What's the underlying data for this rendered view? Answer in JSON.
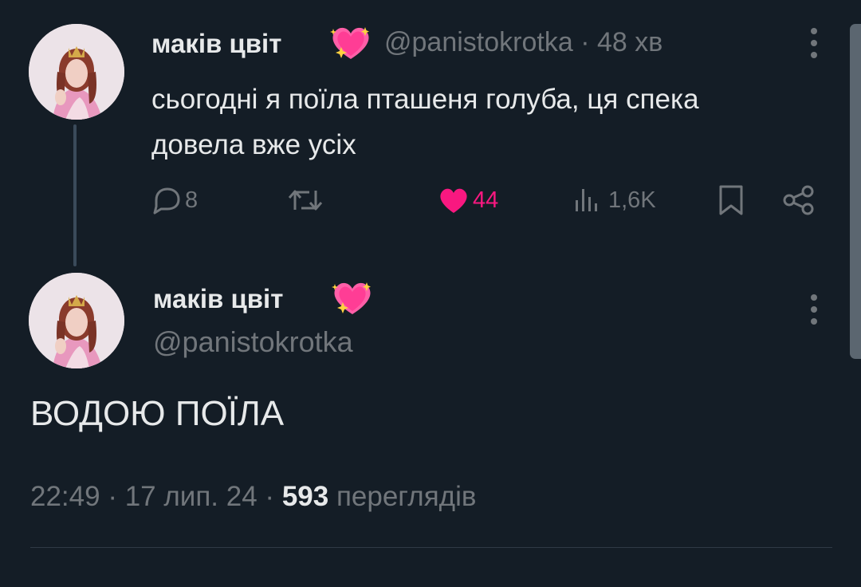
{
  "reply_tweet": {
    "display_name": "маків цвіт",
    "name_emoji": "sparkling-heart-icon",
    "handle": "@panistokrotka",
    "separator": "·",
    "time_ago": "48 хв",
    "text": "сьогодні я поїла пташеня голуба, ця спека довела вже усіх",
    "actions": {
      "reply_count": "8",
      "retweet_count": "",
      "like_count": "44",
      "view_count": "1,6K"
    }
  },
  "main_tweet": {
    "display_name": "маків цвіт",
    "name_emoji": "sparkling-heart-icon",
    "handle": "@panistokrotka",
    "text": "ВОДОЮ ПОЇЛА",
    "time": "22:49",
    "date": "17 лип. 24",
    "separator": "·",
    "views_count": "593",
    "views_label": "переглядів"
  },
  "colors": {
    "background": "#141d26",
    "text_primary": "#e7e9ea",
    "text_secondary": "#71767b",
    "like_active": "#f91880",
    "thread_line": "#3a4a5a"
  }
}
